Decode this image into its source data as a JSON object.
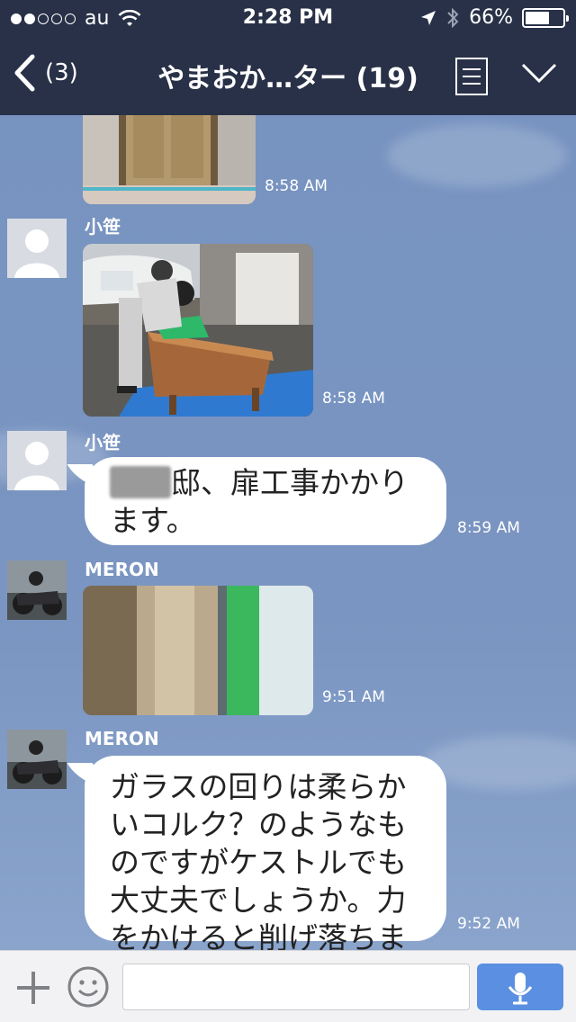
{
  "status_bar": {
    "carrier": "au",
    "time": "2:28 PM",
    "battery_percent": "66%",
    "battery_level": 0.66,
    "signal_dots_on": 2,
    "signal_dots_total": 5
  },
  "nav": {
    "back_count": "(3)",
    "title": "やまおか…ター (19)"
  },
  "messages": [
    {
      "type": "photo",
      "sender": "",
      "time": "8:58 AM",
      "image": "front-door-photo"
    },
    {
      "type": "photo",
      "sender": "小笹",
      "time": "8:58 AM",
      "image": "workbench-photo"
    },
    {
      "type": "text",
      "sender": "小笹",
      "time": "8:59 AM",
      "text_after_redaction": "邸、扉工事かかります。"
    },
    {
      "type": "photo",
      "sender": "MERON",
      "time": "9:51 AM",
      "image": "wood-frame-photo"
    },
    {
      "type": "text",
      "sender": "MERON",
      "time": "9:52 AM",
      "text": "ガラスの回りは柔らかいコルク？のようなものですがケストルでも大丈夫でしょうか。力をかけると削げ落ちます"
    }
  ],
  "input": {
    "placeholder": ""
  },
  "colors": {
    "header_bg": "#283147",
    "chat_bg": "#7591bf",
    "mic_button": "#5b8fe2"
  }
}
